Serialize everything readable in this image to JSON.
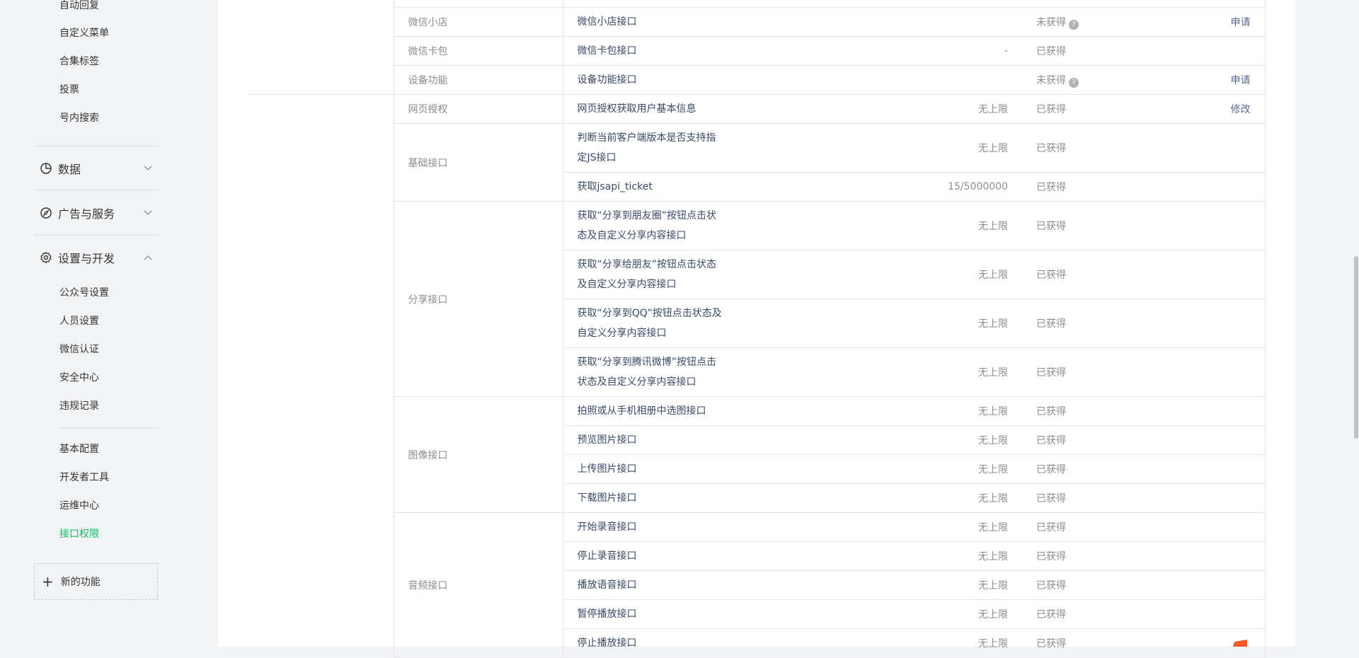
{
  "sidebar": {
    "top_items": [
      "自动回复",
      "自定义菜单",
      "合集标签",
      "投票",
      "号内搜索"
    ],
    "groups": {
      "data": "数据",
      "ads": "广告与服务",
      "settings": "设置与开发"
    },
    "settings_items": [
      "公众号设置",
      "人员设置",
      "微信认证",
      "安全中心",
      "违规记录"
    ],
    "dev_items": [
      "基本配置",
      "开发者工具",
      "运维中心",
      "接口权限"
    ],
    "new_feature": "新的功能",
    "active_color": "#07c160"
  },
  "table": {
    "categories": {
      "wx_shop": "微信小店",
      "wx_card": "微信卡包",
      "device": "设备功能",
      "web_auth": "网页授权",
      "basic": "基础接口",
      "share": "分享接口",
      "image": "图像接口",
      "audio": "音频接口"
    },
    "rows": [
      {
        "name": "微信小店接口",
        "limit": "",
        "status": "未获得",
        "action": "申请"
      },
      {
        "name": "微信卡包接口",
        "limit": "-",
        "status": "已获得",
        "action": ""
      },
      {
        "name": "设备功能接口",
        "limit": "",
        "status": "未获得",
        "action": "申请"
      },
      {
        "name": "网页授权获取用户基本信息",
        "limit": "无上限",
        "status": "已获得",
        "action": "修改"
      },
      {
        "name_line1": "判断当前客户端版本是否支持指",
        "name_line2": "定JS接口",
        "limit": "无上限",
        "status": "已获得"
      },
      {
        "name": "获取jsapi_ticket",
        "limit": "15/5000000",
        "status": "已获得"
      },
      {
        "name_line1": "获取“分享到朋友圈”按钮点击状",
        "name_line2": "态及自定义分享内容接口",
        "limit": "无上限",
        "status": "已获得"
      },
      {
        "name_line1": "获取“分享给朋友”按钮点击状态",
        "name_line2": "及自定义分享内容接口",
        "limit": "无上限",
        "status": "已获得"
      },
      {
        "name_line1": "获取“分享到QQ”按钮点击状态及",
        "name_line2": "自定义分享内容接口",
        "limit": "无上限",
        "status": "已获得"
      },
      {
        "name_line1": "获取“分享到腾讯微博”按钮点击",
        "name_line2": "状态及自定义分享内容接口",
        "limit": "无上限",
        "status": "已获得"
      },
      {
        "name": "拍照或从手机相册中选图接口",
        "limit": "无上限",
        "status": "已获得"
      },
      {
        "name": "预览图片接口",
        "limit": "无上限",
        "status": "已获得"
      },
      {
        "name": "上传图片接口",
        "limit": "无上限",
        "status": "已获得"
      },
      {
        "name": "下载图片接口",
        "limit": "无上限",
        "status": "已获得"
      },
      {
        "name": "开始录音接口",
        "limit": "无上限",
        "status": "已获得"
      },
      {
        "name": "停止录音接口",
        "limit": "无上限",
        "status": "已获得"
      },
      {
        "name": "播放语音接口",
        "limit": "无上限",
        "status": "已获得"
      },
      {
        "name": "暂停播放接口",
        "limit": "无上限",
        "status": "已获得"
      },
      {
        "name": "停止播放接口",
        "limit": "无上限",
        "status": "已获得"
      }
    ]
  },
  "colors": {
    "link": "#576b95",
    "name": "#3a4966",
    "muted": "#8d8d8d"
  },
  "icons": [
    "chart-icon",
    "compass-icon",
    "gear-icon",
    "chevron-down-icon",
    "chevron-up-icon",
    "plus-icon",
    "question-icon"
  ]
}
